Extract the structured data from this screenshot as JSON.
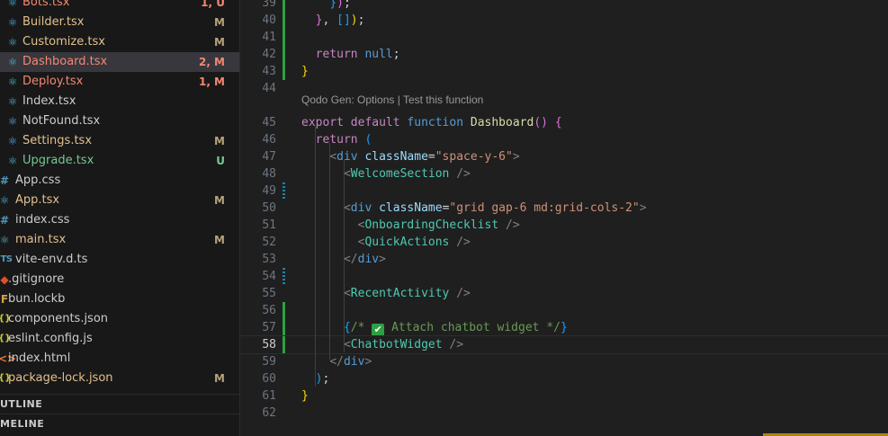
{
  "explorer": {
    "files": [
      {
        "name": "Bots.tsx",
        "status": "1, U",
        "icon": "react-icon",
        "state": "error"
      },
      {
        "name": "Builder.tsx",
        "status": "M",
        "icon": "react-icon",
        "state": "modified"
      },
      {
        "name": "Customize.tsx",
        "status": "M",
        "icon": "react-icon",
        "state": "modified"
      },
      {
        "name": "Dashboard.tsx",
        "status": "2, M",
        "icon": "react-icon",
        "state": "error",
        "selected": true
      },
      {
        "name": "Deploy.tsx",
        "status": "1, M",
        "icon": "react-icon",
        "state": "error"
      },
      {
        "name": "Index.tsx",
        "status": "",
        "icon": "react-icon",
        "state": "normal"
      },
      {
        "name": "NotFound.tsx",
        "status": "",
        "icon": "react-icon",
        "state": "normal"
      },
      {
        "name": "Settings.tsx",
        "status": "M",
        "icon": "react-icon",
        "state": "modified"
      },
      {
        "name": "Upgrade.tsx",
        "status": "U",
        "icon": "react-icon",
        "state": "untracked"
      },
      {
        "name": "App.css",
        "status": "",
        "icon": "hash-icon",
        "state": "normal"
      },
      {
        "name": "App.tsx",
        "status": "M",
        "icon": "react-icon",
        "state": "modified"
      },
      {
        "name": "index.css",
        "status": "",
        "icon": "hash-icon",
        "state": "normal"
      },
      {
        "name": "main.tsx",
        "status": "M",
        "icon": "react-icon",
        "state": "modified"
      },
      {
        "name": "vite-env.d.ts",
        "status": "",
        "icon": "ts-icon",
        "state": "normal"
      },
      {
        "name": ".gitignore",
        "status": "",
        "icon": "git-icon",
        "state": "normal"
      },
      {
        "name": "bun.lockb",
        "status": "",
        "icon": "lock-icon",
        "state": "normal"
      },
      {
        "name": "components.json",
        "status": "",
        "icon": "braces-icon",
        "state": "normal"
      },
      {
        "name": "eslint.config.js",
        "status": "",
        "icon": "braces-icon",
        "state": "normal"
      },
      {
        "name": "index.html",
        "status": "",
        "icon": "html-icon",
        "state": "normal"
      },
      {
        "name": "package-lock.json",
        "status": "M",
        "icon": "braces-icon",
        "state": "modified"
      }
    ],
    "outline_label": "UTLINE",
    "timeline_label": "MELINE"
  },
  "colors": {
    "modified": "#e2c08d",
    "untracked": "#73c991",
    "error": "#f48771",
    "git_added_gutter": "#2ea043",
    "git_modified_gutter": "#1b81a8"
  },
  "editor": {
    "codelens": "Qodo Gen: Options | Test this function",
    "active_line": "58",
    "lines": [
      {
        "num": "39",
        "text": "    });"
      },
      {
        "num": "40",
        "text": "  }, []);"
      },
      {
        "num": "41",
        "text": ""
      },
      {
        "num": "42",
        "text": "  return null;"
      },
      {
        "num": "43",
        "text": "}"
      },
      {
        "num": "44",
        "text": ""
      },
      {
        "num": "45",
        "text": "export default function Dashboard() {"
      },
      {
        "num": "46",
        "text": "  return ("
      },
      {
        "num": "47",
        "text": "    <div className=\"space-y-6\">"
      },
      {
        "num": "48",
        "text": "      <WelcomeSection />"
      },
      {
        "num": "49",
        "text": ""
      },
      {
        "num": "50",
        "text": "      <div className=\"grid gap-6 md:grid-cols-2\">"
      },
      {
        "num": "51",
        "text": "        <OnboardingChecklist />"
      },
      {
        "num": "52",
        "text": "        <QuickActions />"
      },
      {
        "num": "53",
        "text": "      </div>"
      },
      {
        "num": "54",
        "text": ""
      },
      {
        "num": "55",
        "text": "      <RecentActivity />"
      },
      {
        "num": "56",
        "text": ""
      },
      {
        "num": "57",
        "text": "      {/* ✅ Attach chatbot widget */}"
      },
      {
        "num": "58",
        "text": "      <ChatbotWidget />"
      },
      {
        "num": "59",
        "text": "    </div>"
      },
      {
        "num": "60",
        "text": "  );"
      },
      {
        "num": "61",
        "text": "}"
      },
      {
        "num": "62",
        "text": ""
      }
    ]
  }
}
